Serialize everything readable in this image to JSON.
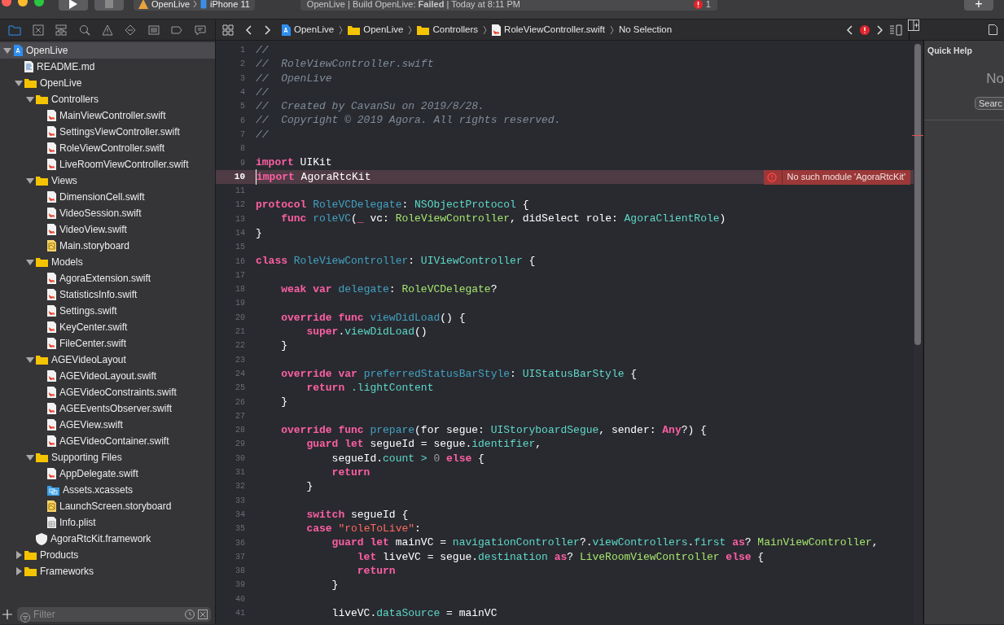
{
  "toolbar": {
    "scheme": "OpenLive",
    "device": "iPhone 11",
    "activity": "OpenLive | Build OpenLive: **Failed** | Today at 8:11 PM",
    "error_count": "1",
    "add_button": "+"
  },
  "navigator_tabs": [
    {
      "kind": "folder",
      "selected": true
    },
    {
      "kind": "source-control",
      "selected": false
    },
    {
      "kind": "hierarchy",
      "selected": false
    },
    {
      "kind": "search",
      "selected": false
    },
    {
      "kind": "warning",
      "selected": false
    },
    {
      "kind": "test",
      "selected": false
    },
    {
      "kind": "debug",
      "selected": false
    },
    {
      "kind": "breakpoint",
      "selected": false
    },
    {
      "kind": "report",
      "selected": false
    }
  ],
  "navigator": {
    "items": [
      {
        "kind": "project",
        "label": "OpenLive",
        "expanded": true,
        "selected": true,
        "children": [
          {
            "kind": "markdown",
            "label": "README.md",
            "selected": false
          },
          {
            "kind": "folder",
            "label": "OpenLive",
            "expanded": true,
            "selected": false,
            "children": [
              {
                "kind": "folder",
                "label": "Controllers",
                "expanded": true,
                "selected": false,
                "children": [
                  {
                    "kind": "swift",
                    "label": "MainViewController.swift",
                    "selected": false
                  },
                  {
                    "kind": "swift",
                    "label": "SettingsViewController.swift",
                    "selected": false
                  },
                  {
                    "kind": "swift",
                    "label": "RoleViewController.swift",
                    "selected": false
                  },
                  {
                    "kind": "swift",
                    "label": "LiveRoomViewController.swift",
                    "selected": false
                  }
                ]
              },
              {
                "kind": "folder",
                "label": "Views",
                "expanded": true,
                "selected": false,
                "children": [
                  {
                    "kind": "swift",
                    "label": "DimensionCell.swift",
                    "selected": false
                  },
                  {
                    "kind": "swift",
                    "label": "VideoSession.swift",
                    "selected": false
                  },
                  {
                    "kind": "swift",
                    "label": "VideoView.swift",
                    "selected": false
                  },
                  {
                    "kind": "storyboard",
                    "label": "Main.storyboard",
                    "selected": false
                  }
                ]
              },
              {
                "kind": "folder",
                "label": "Models",
                "expanded": true,
                "selected": false,
                "children": [
                  {
                    "kind": "swift",
                    "label": "AgoraExtension.swift",
                    "selected": false
                  },
                  {
                    "kind": "swift",
                    "label": "StatisticsInfo.swift",
                    "selected": false
                  },
                  {
                    "kind": "swift",
                    "label": "Settings.swift",
                    "selected": false
                  },
                  {
                    "kind": "swift",
                    "label": "KeyCenter.swift",
                    "selected": false
                  },
                  {
                    "kind": "swift",
                    "label": "FileCenter.swift",
                    "selected": false
                  }
                ]
              },
              {
                "kind": "folder",
                "label": "AGEVideoLayout",
                "expanded": true,
                "selected": false,
                "children": [
                  {
                    "kind": "swift",
                    "label": "AGEVideoLayout.swift",
                    "selected": false
                  },
                  {
                    "kind": "swift",
                    "label": "AGEVideoConstraints.swift",
                    "selected": false
                  },
                  {
                    "kind": "swift",
                    "label": "AGEEventsObserver.swift",
                    "selected": false
                  },
                  {
                    "kind": "swift",
                    "label": "AGEView.swift",
                    "selected": false
                  },
                  {
                    "kind": "swift",
                    "label": "AGEVideoContainer.swift",
                    "selected": false
                  }
                ]
              },
              {
                "kind": "folder",
                "label": "Supporting Files",
                "expanded": true,
                "selected": false,
                "children": [
                  {
                    "kind": "swift",
                    "label": "AppDelegate.swift",
                    "selected": false
                  },
                  {
                    "kind": "assets",
                    "label": "Assets.xcassets",
                    "selected": false
                  },
                  {
                    "kind": "storyboard",
                    "label": "LaunchScreen.storyboard",
                    "selected": false
                  },
                  {
                    "kind": "plist",
                    "label": "Info.plist",
                    "selected": false
                  }
                ]
              },
              {
                "kind": "framework",
                "label": "AgoraRtcKit.framework",
                "selected": false
              }
            ]
          },
          {
            "kind": "folder",
            "label": "Products",
            "expanded": false,
            "selected": false
          },
          {
            "kind": "folder",
            "label": "Frameworks",
            "expanded": false,
            "selected": false
          }
        ]
      }
    ],
    "filter": {
      "placeholder": "Filter"
    }
  },
  "jump_bar": {
    "path": [
      {
        "kind": "project",
        "label": "OpenLive"
      },
      {
        "kind": "folder",
        "label": "OpenLive"
      },
      {
        "kind": "folder",
        "label": "Controllers"
      },
      {
        "kind": "swift",
        "label": "RoleViewController.swift"
      }
    ],
    "selection": "No Selection"
  },
  "editor": {
    "lines": [
      {
        "number": "1",
        "current": false,
        "tokens": [
          {
            "kind": "comment",
            "text": "//"
          }
        ]
      },
      {
        "number": "2",
        "current": false,
        "tokens": [
          {
            "kind": "comment",
            "text": "//  RoleViewController.swift"
          }
        ]
      },
      {
        "number": "3",
        "current": false,
        "tokens": [
          {
            "kind": "comment",
            "text": "//  OpenLive"
          }
        ]
      },
      {
        "number": "4",
        "current": false,
        "tokens": [
          {
            "kind": "comment",
            "text": "//"
          }
        ]
      },
      {
        "number": "5",
        "current": false,
        "tokens": [
          {
            "kind": "comment",
            "text": "//  Created by CavanSu on 2019/8/28."
          }
        ]
      },
      {
        "number": "6",
        "current": false,
        "tokens": [
          {
            "kind": "comment",
            "text": "//  Copyright © 2019 Agora. All rights reserved."
          }
        ]
      },
      {
        "number": "7",
        "current": false,
        "tokens": [
          {
            "kind": "comment",
            "text": "//"
          }
        ]
      },
      {
        "number": "8",
        "current": false
      },
      {
        "number": "9",
        "current": false,
        "tokens": [
          {
            "kind": "keyword",
            "text": "import"
          },
          {
            "kind": "plain",
            "text": " UIKit"
          }
        ]
      },
      {
        "number": "10",
        "current": true,
        "error": "No such module 'AgoraRtcKit'",
        "tokens": [
          {
            "kind": "keyword",
            "text": "import"
          },
          {
            "kind": "plain",
            "text": " AgoraRtcKit"
          }
        ]
      },
      {
        "number": "11",
        "current": false
      },
      {
        "number": "12",
        "current": false,
        "tokens": [
          {
            "kind": "keyword",
            "text": "protocol "
          },
          {
            "kind": "declaration",
            "text": "RoleVCDelegate"
          },
          {
            "kind": "plain",
            "text": ": "
          },
          {
            "kind": "type",
            "text": "NSObjectProtocol"
          },
          {
            "kind": "plain",
            "text": " {"
          }
        ]
      },
      {
        "number": "13",
        "current": false,
        "tokens": [
          {
            "kind": "keyword",
            "text": "    func "
          },
          {
            "kind": "declaration",
            "text": "roleVC"
          },
          {
            "kind": "plain",
            "text": "("
          },
          {
            "kind": "keyword",
            "text": "_"
          },
          {
            "kind": "plain",
            "text": " vc: "
          },
          {
            "kind": "project-type",
            "text": "RoleViewController"
          },
          {
            "kind": "plain",
            "text": ", didSelect role: "
          },
          {
            "kind": "type",
            "text": "AgoraClientRole"
          },
          {
            "kind": "plain",
            "text": ")"
          }
        ]
      },
      {
        "number": "14",
        "current": false,
        "tokens": [
          {
            "kind": "plain",
            "text": "}"
          }
        ]
      },
      {
        "number": "15",
        "current": false
      },
      {
        "number": "16",
        "current": false,
        "tokens": [
          {
            "kind": "keyword",
            "text": "class "
          },
          {
            "kind": "declaration",
            "text": "RoleViewController"
          },
          {
            "kind": "plain",
            "text": ": "
          },
          {
            "kind": "type",
            "text": "UIViewController"
          },
          {
            "kind": "plain",
            "text": " {"
          }
        ]
      },
      {
        "number": "17",
        "current": false
      },
      {
        "number": "18",
        "current": false,
        "tokens": [
          {
            "kind": "keyword",
            "text": "    weak var "
          },
          {
            "kind": "declaration",
            "text": "delegate"
          },
          {
            "kind": "plain",
            "text": ": "
          },
          {
            "kind": "project-type",
            "text": "RoleVCDelegate"
          },
          {
            "kind": "plain",
            "text": "?"
          }
        ]
      },
      {
        "number": "19",
        "current": false
      },
      {
        "number": "20",
        "current": false,
        "tokens": [
          {
            "kind": "keyword",
            "text": "    override func "
          },
          {
            "kind": "declaration",
            "text": "viewDidLoad"
          },
          {
            "kind": "plain",
            "text": "() {"
          }
        ]
      },
      {
        "number": "21",
        "current": false,
        "tokens": [
          {
            "kind": "keyword",
            "text": "        super"
          },
          {
            "kind": "plain",
            "text": "."
          },
          {
            "kind": "type",
            "text": "viewDidLoad"
          },
          {
            "kind": "plain",
            "text": "()"
          }
        ]
      },
      {
        "number": "22",
        "current": false,
        "tokens": [
          {
            "kind": "plain",
            "text": "    }"
          }
        ]
      },
      {
        "number": "23",
        "current": false
      },
      {
        "number": "24",
        "current": false,
        "tokens": [
          {
            "kind": "keyword",
            "text": "    override var "
          },
          {
            "kind": "declaration",
            "text": "preferredStatusBarStyle"
          },
          {
            "kind": "plain",
            "text": ": "
          },
          {
            "kind": "type",
            "text": "UIStatusBarStyle"
          },
          {
            "kind": "plain",
            "text": " {"
          }
        ]
      },
      {
        "number": "25",
        "current": false,
        "tokens": [
          {
            "kind": "keyword",
            "text": "        return "
          },
          {
            "kind": "type",
            "text": ".lightContent"
          }
        ]
      },
      {
        "number": "26",
        "current": false,
        "tokens": [
          {
            "kind": "plain",
            "text": "    }"
          }
        ]
      },
      {
        "number": "27",
        "current": false
      },
      {
        "number": "28",
        "current": false,
        "tokens": [
          {
            "kind": "keyword",
            "text": "    override func "
          },
          {
            "kind": "declaration",
            "text": "prepare"
          },
          {
            "kind": "plain",
            "text": "(for segue: "
          },
          {
            "kind": "type",
            "text": "UIStoryboardSegue"
          },
          {
            "kind": "plain",
            "text": ", sender: "
          },
          {
            "kind": "keyword",
            "text": "Any"
          },
          {
            "kind": "plain",
            "text": "?) {"
          }
        ]
      },
      {
        "number": "29",
        "current": false,
        "tokens": [
          {
            "kind": "keyword",
            "text": "        guard let"
          },
          {
            "kind": "plain",
            "text": " segueId = segue."
          },
          {
            "kind": "type",
            "text": "identifier"
          },
          {
            "kind": "plain",
            "text": ","
          }
        ]
      },
      {
        "number": "30",
        "current": false,
        "tokens": [
          {
            "kind": "plain",
            "text": "            segueId."
          },
          {
            "kind": "type",
            "text": "count >"
          },
          {
            "kind": "number",
            "text": " 0"
          },
          {
            "kind": "keyword",
            "text": " else"
          },
          {
            "kind": "plain",
            "text": " {"
          }
        ]
      },
      {
        "number": "31",
        "current": false,
        "tokens": [
          {
            "kind": "keyword",
            "text": "            return"
          }
        ]
      },
      {
        "number": "32",
        "current": false,
        "tokens": [
          {
            "kind": "plain",
            "text": "        }"
          }
        ]
      },
      {
        "number": "33",
        "current": false
      },
      {
        "number": "34",
        "current": false,
        "tokens": [
          {
            "kind": "keyword",
            "text": "        switch"
          },
          {
            "kind": "plain",
            "text": " segueId {"
          }
        ]
      },
      {
        "number": "35",
        "current": false,
        "tokens": [
          {
            "kind": "keyword",
            "text": "        case "
          },
          {
            "kind": "string",
            "text": "\"roleToLive\""
          },
          {
            "kind": "plain",
            "text": ":"
          }
        ]
      },
      {
        "number": "36",
        "current": false,
        "tokens": [
          {
            "kind": "keyword",
            "text": "            guard let"
          },
          {
            "kind": "plain",
            "text": " mainVC = "
          },
          {
            "kind": "type",
            "text": "navigationController"
          },
          {
            "kind": "plain",
            "text": "?."
          },
          {
            "kind": "type",
            "text": "viewControllers"
          },
          {
            "kind": "plain",
            "text": "."
          },
          {
            "kind": "type",
            "text": "first"
          },
          {
            "kind": "keyword",
            "text": " as"
          },
          {
            "kind": "plain",
            "text": "? "
          },
          {
            "kind": "project-type",
            "text": "MainViewController"
          },
          {
            "kind": "plain",
            "text": ","
          }
        ]
      },
      {
        "number": "37",
        "current": false,
        "tokens": [
          {
            "kind": "keyword",
            "text": "                let"
          },
          {
            "kind": "plain",
            "text": " liveVC = segue."
          },
          {
            "kind": "type",
            "text": "destination"
          },
          {
            "kind": "keyword",
            "text": " as"
          },
          {
            "kind": "plain",
            "text": "? "
          },
          {
            "kind": "project-type",
            "text": "LiveRoomViewController"
          },
          {
            "kind": "keyword",
            "text": " else"
          },
          {
            "kind": "plain",
            "text": " {"
          }
        ]
      },
      {
        "number": "38",
        "current": false,
        "tokens": [
          {
            "kind": "keyword",
            "text": "                return"
          }
        ]
      },
      {
        "number": "39",
        "current": false,
        "tokens": [
          {
            "kind": "plain",
            "text": "            }"
          }
        ]
      },
      {
        "number": "40",
        "current": false
      },
      {
        "number": "41",
        "current": false,
        "tokens": [
          {
            "kind": "plain",
            "text": "            liveVC."
          },
          {
            "kind": "type",
            "text": "dataSource"
          },
          {
            "kind": "plain",
            "text": " = mainVC"
          }
        ]
      }
    ]
  },
  "inspector": {
    "title": "Quick Help",
    "message": "No",
    "button": "Searc"
  }
}
